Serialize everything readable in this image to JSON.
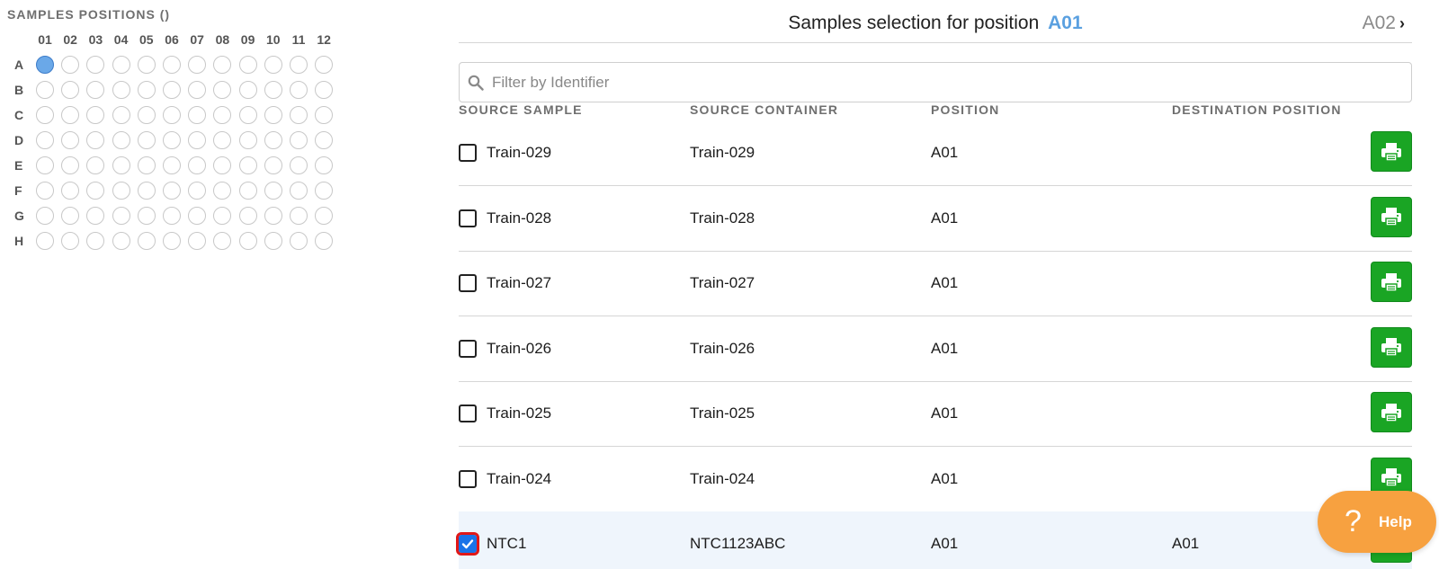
{
  "plate": {
    "title": "SAMPLES POSITIONS ()",
    "columns": [
      "01",
      "02",
      "03",
      "04",
      "05",
      "06",
      "07",
      "08",
      "09",
      "10",
      "11",
      "12"
    ],
    "rows": [
      "A",
      "B",
      "C",
      "D",
      "E",
      "F",
      "G",
      "H"
    ],
    "selected_well": "A01"
  },
  "panel": {
    "title_prefix": "Samples selection for position",
    "current_position": "A01",
    "next_position": "A02",
    "next_chevron": "›"
  },
  "filter": {
    "placeholder": "Filter by Identifier",
    "value": ""
  },
  "table": {
    "headers": {
      "source_sample": "SOURCE SAMPLE",
      "source_container": "SOURCE CONTAINER",
      "position": "POSITION",
      "destination_position": "DESTINATION POSITION"
    },
    "rows": [
      {
        "sample": "Train-029",
        "container": "Train-029",
        "position": "A01",
        "destination": "",
        "checked": false
      },
      {
        "sample": "Train-028",
        "container": "Train-028",
        "position": "A01",
        "destination": "",
        "checked": false
      },
      {
        "sample": "Train-027",
        "container": "Train-027",
        "position": "A01",
        "destination": "",
        "checked": false
      },
      {
        "sample": "Train-026",
        "container": "Train-026",
        "position": "A01",
        "destination": "",
        "checked": false
      },
      {
        "sample": "Train-025",
        "container": "Train-025",
        "position": "A01",
        "destination": "",
        "checked": false
      },
      {
        "sample": "Train-024",
        "container": "Train-024",
        "position": "A01",
        "destination": "",
        "checked": false
      },
      {
        "sample": "NTC1",
        "container": "NTC1123ABC",
        "position": "A01",
        "destination": "A01",
        "checked": true
      }
    ]
  },
  "help": {
    "icon": "?",
    "label": "Help"
  },
  "colors": {
    "accent_blue": "#5aa0e0",
    "print_green": "#1aa524",
    "help_orange": "#f7a140",
    "selected_well": "#6aa8e8",
    "checked_row_bg": "#eff5fc"
  },
  "icons": {
    "search": "search-icon",
    "print": "printer-icon",
    "check": "check-icon",
    "next": "chevron-right-icon"
  }
}
